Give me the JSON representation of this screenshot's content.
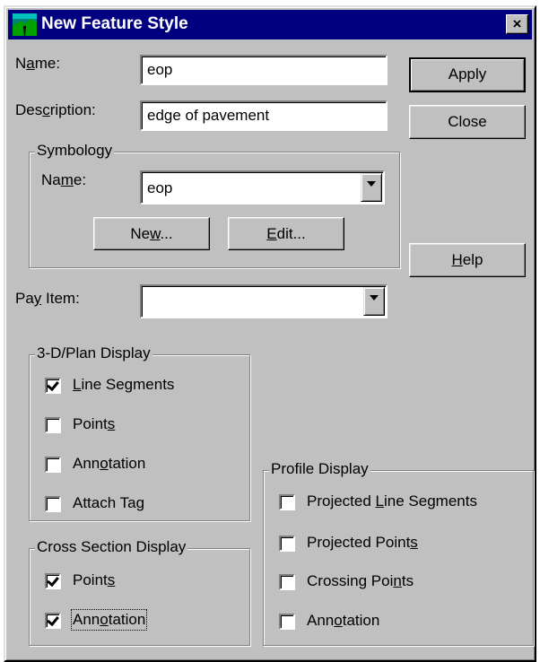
{
  "window": {
    "title": "New Feature Style",
    "close_glyph": "×",
    "app_icon": "terrain-icon"
  },
  "form": {
    "name_label_pre": "N",
    "name_label_u": "a",
    "name_label_post": "me:",
    "name_value": "eop",
    "desc_label_pre": "Des",
    "desc_label_u": "c",
    "desc_label_post": "ription:",
    "desc_value": "edge of pavement",
    "payitem_label_pre": "Pa",
    "payitem_label_u": "y",
    "payitem_label_post": " Item:",
    "payitem_value": ""
  },
  "symbology": {
    "title": "Symbology",
    "name_label_pre": "Na",
    "name_label_u": "m",
    "name_label_post": "e:",
    "name_value": "eop",
    "new_pre": "Ne",
    "new_u": "w",
    "new_post": "...",
    "edit_pre": "",
    "edit_u": "E",
    "edit_post": "dit..."
  },
  "buttons": {
    "apply": "Apply",
    "close": "Close",
    "help_u": "H",
    "help_post": "elp"
  },
  "plan_display": {
    "title": "3-D/Plan Display",
    "items": [
      {
        "pre": "",
        "u": "L",
        "post": "ine Segments",
        "checked": true
      },
      {
        "pre": "Point",
        "u": "s",
        "post": "",
        "checked": false
      },
      {
        "pre": "Ann",
        "u": "o",
        "post": "tation",
        "checked": false
      },
      {
        "pre": "Attach Ta",
        "u": "g",
        "post": "",
        "checked": false
      }
    ]
  },
  "cross_section": {
    "title": "Cross Section Display",
    "items": [
      {
        "pre": "Point",
        "u": "s",
        "post": "",
        "checked": true
      },
      {
        "pre": "Ann",
        "u": "o",
        "post": "tation",
        "checked": true
      }
    ]
  },
  "profile_display": {
    "title": "Profile Display",
    "items": [
      {
        "pre": "Projected ",
        "u": "L",
        "post": "ine Segments",
        "checked": false
      },
      {
        "pre": "Projected Point",
        "u": "s",
        "post": "",
        "checked": false
      },
      {
        "pre": "Crossing Poi",
        "u": "n",
        "post": "ts",
        "checked": false
      },
      {
        "pre": "Ann",
        "u": "o",
        "post": "tation",
        "checked": false
      }
    ]
  }
}
